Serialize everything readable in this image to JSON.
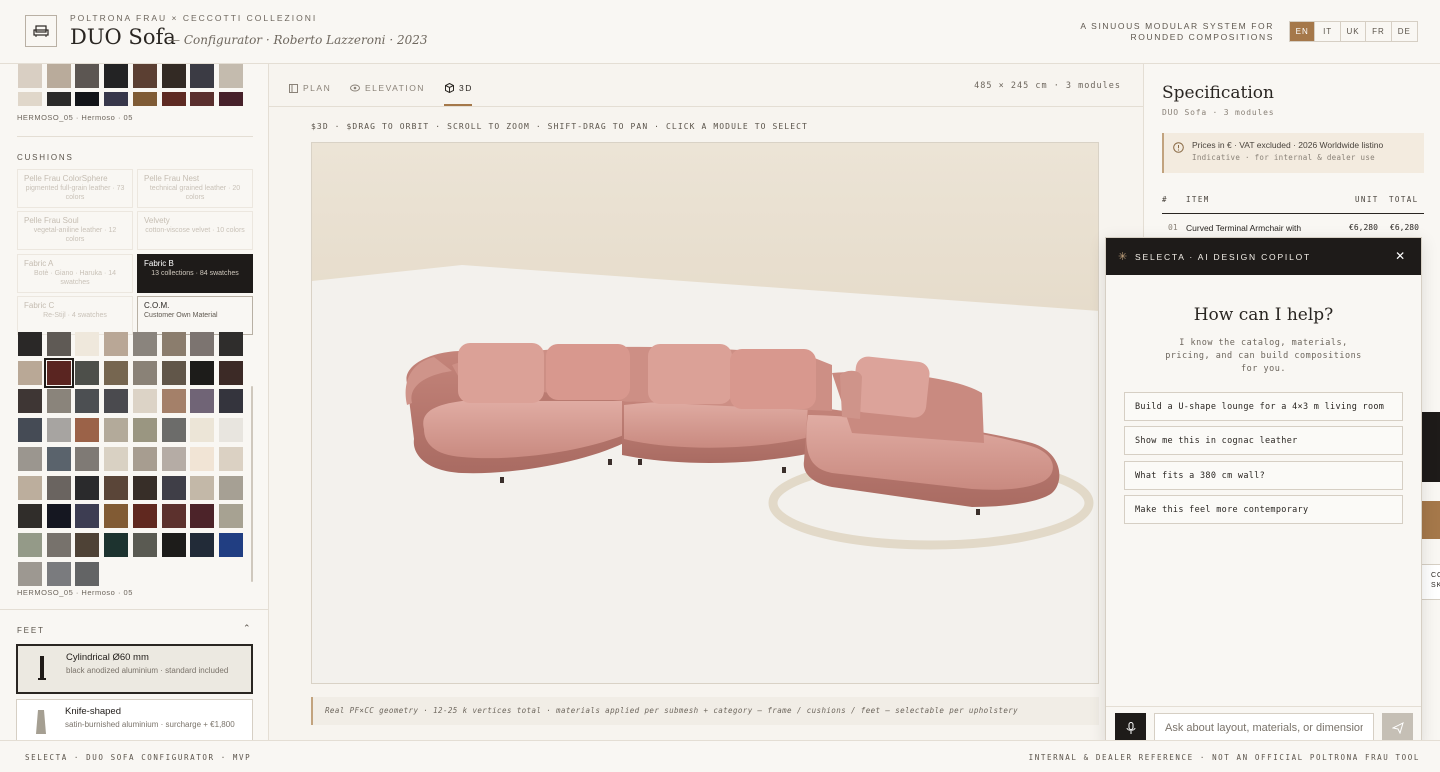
{
  "header": {
    "brand": "POLTRONA FRAU × CECCOTTI COLLEZIONI",
    "title": "DUO Sofa",
    "subtitle": "— Configurator · Roberto Lazzeroni · 2023",
    "tagline_1": "A SINUOUS MODULAR SYSTEM FOR",
    "tagline_2": "ROUNDED COMPOSITIONS",
    "languages": [
      "EN",
      "IT",
      "UK",
      "FR",
      "DE"
    ],
    "active_language": "EN"
  },
  "left": {
    "frame_swatch_label": "HERMOSO_05 · Hermoso · 05",
    "frame_swatches": [
      "#d9cfc3",
      "#b9ab9b",
      "#5c5652",
      "#232324",
      "#5b3f32",
      "#332a24",
      "#3b3b44",
      "#c4bbae",
      "#e0d7ca",
      "#2b2a29",
      "#121418",
      "#37374a",
      "#7f5b35",
      "#5e2a22",
      "#5a2f2d",
      "#47212a"
    ],
    "cushions_title": "CUSHIONS",
    "materials": [
      {
        "name": "Pelle Frau ColorSphere",
        "desc": "pigmented full-grain leather · 73 colors"
      },
      {
        "name": "Pelle Frau Nest",
        "desc": "technical grained leather · 20 colors"
      },
      {
        "name": "Pelle Frau Soul",
        "desc": "vegetal-aniline leather · 12 colors"
      },
      {
        "name": "Velvety",
        "desc": "cotton-viscose velvet · 10 colors"
      },
      {
        "name": "Fabric A",
        "desc": "Botè · Giano · Haruka · 14 swatches"
      },
      {
        "name": "Fabric B",
        "desc": "13 collections · 84 swatches"
      },
      {
        "name": "Fabric C",
        "desc": "Re-Stijl · 4 swatches"
      },
      {
        "name": "C.O.M.",
        "desc": "Customer Own Material"
      }
    ],
    "cushion_swatches": [
      "#2a2827",
      "#5f5a55",
      "#efe8dc",
      "#b9a796",
      "#8a847d",
      "#8b7d6d",
      "#7c7470",
      "#2f2d2c",
      "#b9a896",
      "#5a2521",
      "#4d4f4a",
      "#766650",
      "#8a8277",
      "#615649",
      "#1d1c1a",
      "#3c2a26",
      "#3e3634",
      "#8a847b",
      "#4c4f52",
      "#4a4a4e",
      "#dcd3c6",
      "#a48069",
      "#706476",
      "#34343d",
      "#454b55",
      "#a7a4a1",
      "#9b6248",
      "#b3aa9a",
      "#9a9681",
      "#6c6c6a",
      "#ece5d7",
      "#e8e5df",
      "#9b968f",
      "#5a636c",
      "#7f7a75",
      "#d9d1c3",
      "#a79d90",
      "#b5aca5",
      "#f1e4d5",
      "#dbd1c3",
      "#bcae9d",
      "#6a6460",
      "#2a2a2c",
      "#5a4538",
      "#372e28",
      "#3f3e47",
      "#c3b8a8",
      "#a6a094",
      "#302d2a",
      "#151721",
      "#3d3d52",
      "#815b34",
      "#60281f",
      "#5c312d",
      "#4c2329",
      "#a7a292",
      "#949a88",
      "#77726c",
      "#4e4236",
      "#1d332f",
      "#5a5a52",
      "#1d1c1a",
      "#222b38",
      "#213e82",
      "#9d9891",
      "#7a7b7e",
      "#636465"
    ],
    "selected_swatch_index": 9,
    "cushion_swatch_label": "HERMOSO_05 · Hermoso · 05",
    "feet_title": "FEET",
    "feet": [
      {
        "name": "Cylindrical Ø60 mm",
        "desc": "black anodized aluminium · standard included"
      },
      {
        "name": "Knife-shaped",
        "desc": "satin-burnished aluminium · surcharge + €1,800"
      }
    ]
  },
  "center": {
    "tabs": [
      "PLAN",
      "ELEVATION",
      "3D"
    ],
    "active_tab": "3D",
    "dims": "485 × 245 cm · 3 modules",
    "hint": "$3D · $DRAG TO ORBIT · SCROLL TO ZOOM · SHIFT-DRAG TO PAN · CLICK A MODULE TO SELECT",
    "note": "Real PF×CC geometry · 12-25 k vertices total · materials applied per submesh + category — frame / cushions / feet — selectable per upholstery",
    "sofa_color": "#d49990"
  },
  "spec": {
    "title": "Specification",
    "subtitle": "DUO Sofa · 3 modules",
    "price_note": "Prices in € · VAT excluded · 2026 Worldwide listino",
    "price_sub": "Indicative · for internal & dealer use",
    "columns": [
      "#",
      "ITEM",
      "UNIT",
      "TOTAL"
    ],
    "rows": [
      {
        "num": "01",
        "item": "Curved Terminal Armchair with",
        "unit": "€6,280",
        "total": "€6,280"
      }
    ]
  },
  "chat": {
    "title": "SELECTA · AI DESIGN COPILOT",
    "heading": "How can I help?",
    "desc": "I know the catalog, materials, pricing, and can build compositions for you.",
    "suggestions": [
      "Build a U-shape lounge for a 4×3 m living room",
      "Show me this in cognac leather",
      "What fits a 380 cm wall?",
      "Make this feel more contemporary"
    ],
    "placeholder": "Ask about layout, materials, or dimensions"
  },
  "right_edge": {
    "text_1": "CO",
    "text_2": "SK"
  },
  "footer": {
    "left": "SELECTA · DUO SOFA CONFIGURATOR · MVP",
    "right": "INTERNAL & DEALER REFERENCE · NOT AN OFFICIAL POLTRONA FRAU TOOL"
  }
}
